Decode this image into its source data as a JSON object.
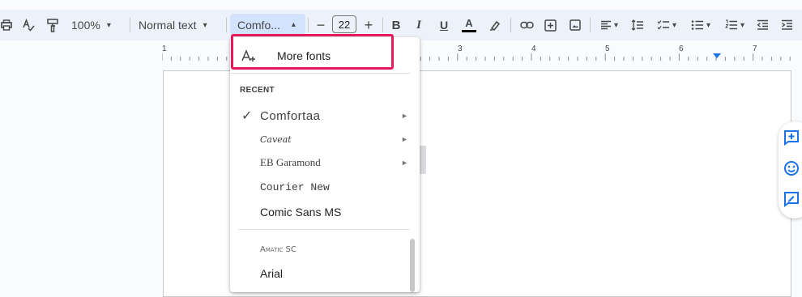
{
  "toolbar": {
    "zoom": "100%",
    "style": "Normal text",
    "font": "Comfo...",
    "font_size": "22",
    "minus": "−",
    "plus": "+",
    "bold": "B",
    "italic": "I",
    "underline": "U",
    "text_color": "A",
    "caret": "▾",
    "caret_up": "▴",
    "icons": [
      "print-icon",
      "spellcheck-icon",
      "paint-format-icon",
      "highlighter-icon",
      "link-icon",
      "add-comment-icon",
      "insert-image-icon",
      "align-icon",
      "line-spacing-icon",
      "checklist-icon",
      "bulleted-list-icon",
      "numbered-list-icon",
      "decrease-indent-icon",
      "increase-indent-icon"
    ]
  },
  "ruler": {
    "numbers": [
      "1",
      "2",
      "3",
      "4",
      "5",
      "6",
      "7"
    ]
  },
  "font_menu": {
    "more_fonts_label": "More fonts",
    "recent_label": "RECENT",
    "checkmark": "✓",
    "submenu_arrow": "►",
    "recent": [
      {
        "name": "Comfortaa",
        "selected": true,
        "has_submenu": true
      },
      {
        "name": "Caveat",
        "selected": false,
        "has_submenu": true
      },
      {
        "name": "EB Garamond",
        "selected": false,
        "has_submenu": true
      },
      {
        "name": "Courier New",
        "selected": false,
        "has_submenu": false
      },
      {
        "name": "Comic Sans MS",
        "selected": false,
        "has_submenu": false
      }
    ],
    "all_fonts": [
      "Amatic SC",
      "Arial"
    ]
  },
  "colors": {
    "highlight_border": "#e8195a",
    "toolbar_bg": "#edf2fa",
    "active_dropdown": "#d3e3fd",
    "side_icons": "#1a73e8"
  },
  "side_panel": {
    "icons": [
      "add-comment-icon",
      "emoji-reaction-icon",
      "suggest-edits-icon"
    ]
  }
}
